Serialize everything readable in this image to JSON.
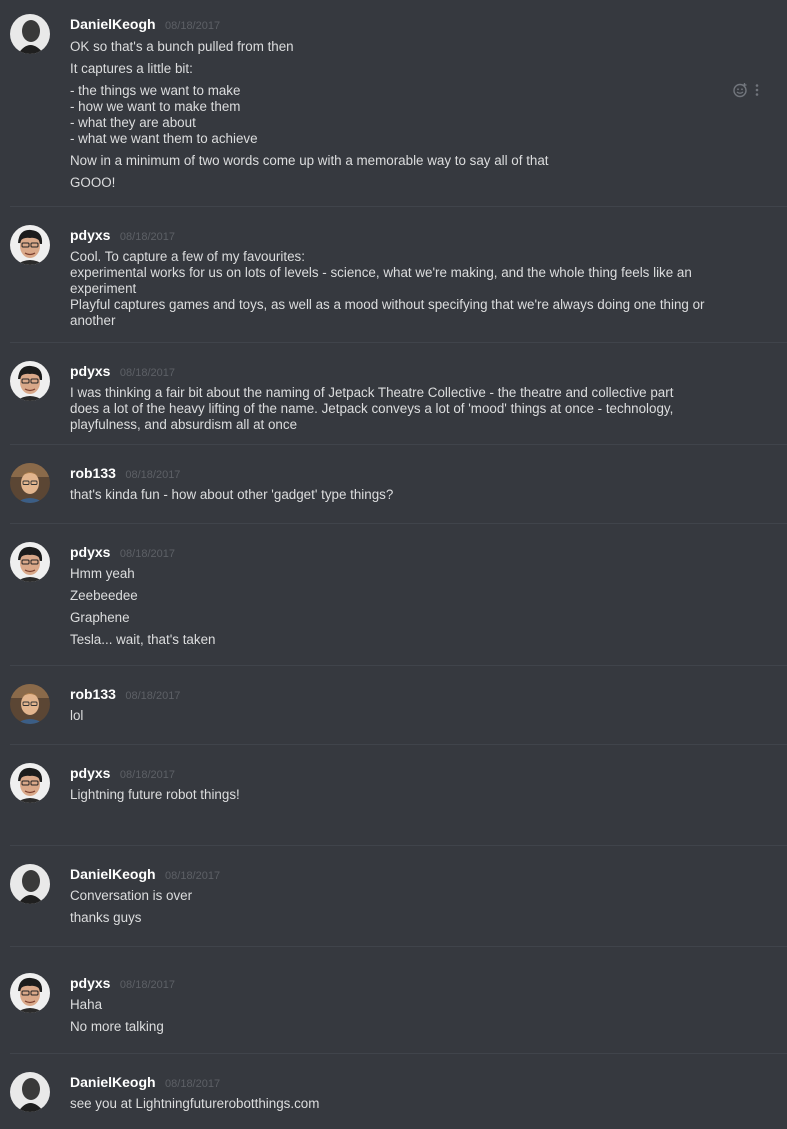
{
  "users": {
    "daniel": "DanielKeogh",
    "pdyxs": "pdyxs",
    "rob": "rob133"
  },
  "timestamp": "08/18/2017",
  "messages": [
    {
      "author": "DanielKeogh",
      "date": "08/18/2017",
      "lines": [
        "OK so that's a bunch pulled from then",
        "It captures a little bit:",
        "- the things we want to make",
        "- how we want to make them",
        "- what they are about",
        "- what we want them to achieve",
        "Now in a minimum of two words come up with a memorable way to say all of that",
        "GOOO!"
      ]
    },
    {
      "author": "pdyxs",
      "date": "08/18/2017",
      "lines": [
        "Cool. To capture a few of my favourites:",
        "experimental works for us on lots of levels - science, what we're making, and the whole thing feels like an",
        "experiment",
        "Playful captures games and toys, as well as a mood without specifying that we're always doing one thing or",
        "another"
      ]
    },
    {
      "author": "pdyxs",
      "date": "08/18/2017",
      "lines": [
        "I was thinking a fair bit about the naming of Jetpack Theatre Collective - the theatre and collective part",
        "does a lot of the heavy lifting of the name. Jetpack conveys a lot of 'mood' things at once - technology,",
        "playfulness, and absurdism all at once"
      ]
    },
    {
      "author": "rob133",
      "date": "08/18/2017",
      "lines": [
        "that's kinda fun - how about other 'gadget' type things?"
      ]
    },
    {
      "author": "pdyxs",
      "date": "08/18/2017",
      "lines": [
        "Hmm yeah",
        "Zeebeedee",
        "Graphene",
        "Tesla... wait, that's taken"
      ]
    },
    {
      "author": "rob133",
      "date": "08/18/2017",
      "lines": [
        "lol"
      ]
    },
    {
      "author": "pdyxs",
      "date": "08/18/2017",
      "lines": [
        "Lightning future robot things!"
      ]
    },
    {
      "author": "DanielKeogh",
      "date": "08/18/2017",
      "lines": [
        "Conversation is over",
        "thanks guys"
      ]
    },
    {
      "author": "pdyxs",
      "date": "08/18/2017",
      "lines": [
        "Haha",
        "No more talking"
      ]
    },
    {
      "author": "DanielKeogh",
      "date": "08/18/2017",
      "lines": [
        "see you at Lightningfuturerobotthings.com"
      ]
    }
  ],
  "colors": {
    "background": "#36393f",
    "username": "#ffffff",
    "text": "#dcddde",
    "timestamp": "#5d6066",
    "divider": "#40444b"
  },
  "icons": {
    "reaction": "add-reaction-icon",
    "more": "more-options-icon"
  }
}
